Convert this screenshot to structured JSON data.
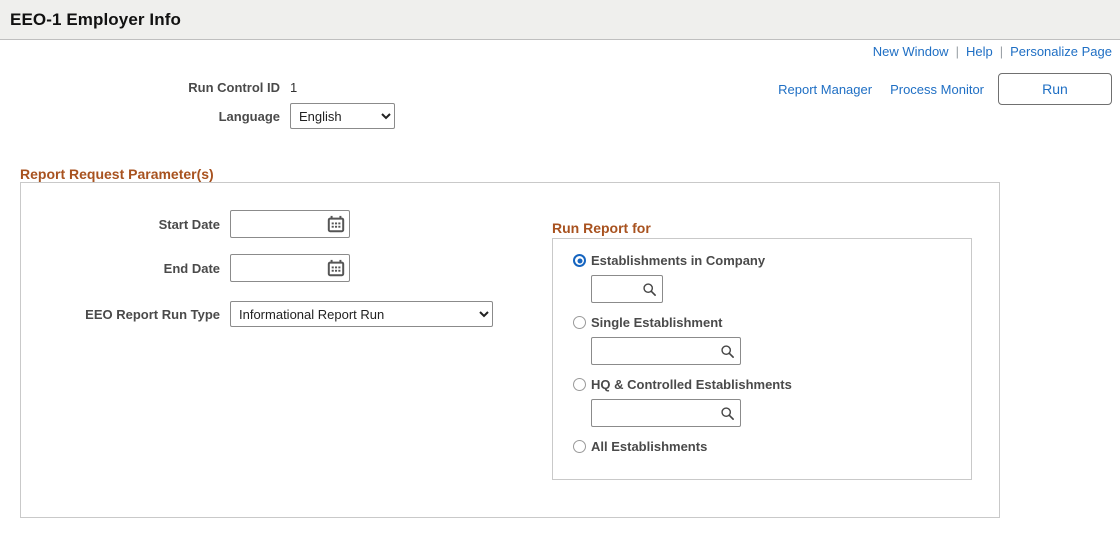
{
  "header": {
    "title": "EEO-1 Employer Info"
  },
  "util_links": {
    "new_window": "New Window",
    "help": "Help",
    "personalize": "Personalize Page",
    "separator": "|"
  },
  "actions": {
    "report_manager": "Report Manager",
    "process_monitor": "Process Monitor",
    "run": "Run"
  },
  "run_control": {
    "id_label": "Run Control ID",
    "id_value": "1",
    "language_label": "Language",
    "language_value": "English",
    "language_options": [
      "English"
    ]
  },
  "report_params": {
    "section_title": "Report Request Parameter(s)",
    "start_date_label": "Start Date",
    "start_date_value": "",
    "start_date_placeholder": "",
    "end_date_label": "End Date",
    "end_date_value": "",
    "end_date_placeholder": "",
    "run_type_label": "EEO Report Run Type",
    "run_type_value": "Informational Report Run",
    "run_type_options": [
      "Informational Report Run"
    ]
  },
  "run_report_for": {
    "title": "Run Report for",
    "options": [
      {
        "label": "Establishments in Company",
        "selected": true,
        "has_lookup": true,
        "lookup_value": "",
        "lookup_width": "narrow"
      },
      {
        "label": "Single Establishment",
        "selected": false,
        "has_lookup": true,
        "lookup_value": "",
        "lookup_width": "wide"
      },
      {
        "label": "HQ & Controlled Establishments",
        "selected": false,
        "has_lookup": true,
        "lookup_value": "",
        "lookup_width": "wide"
      },
      {
        "label": "All Establishments",
        "selected": false,
        "has_lookup": false,
        "lookup_value": "",
        "lookup_width": ""
      }
    ]
  },
  "icons": {
    "calendar": "calendar-icon",
    "search": "search-icon"
  },
  "colors": {
    "link_blue": "#1f6fc4",
    "section_orange": "#a8521f",
    "radio_selected": "#1665c0",
    "header_bg": "#efefed",
    "label_gray": "#4a4a4a"
  }
}
